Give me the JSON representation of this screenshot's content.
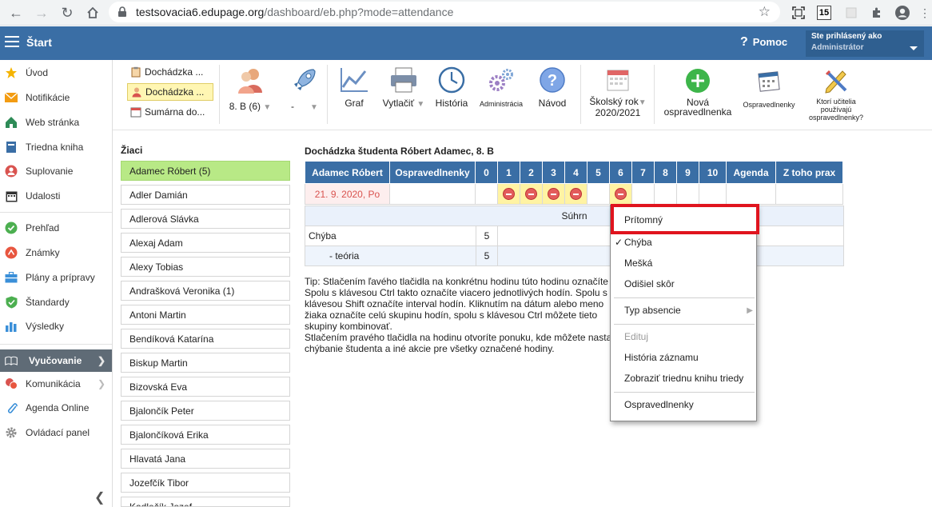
{
  "browser": {
    "host": "testsovacia6.edupage.org",
    "path": "/dashboard/eb.php?mode=attendance",
    "ext_badge": "15"
  },
  "appbar": {
    "title": "Štart",
    "help": "Pomoc",
    "user_line1": "Ste prihlásený ako",
    "user_line2": "Administrátor"
  },
  "sidebar": {
    "items": [
      {
        "label": "Úvod"
      },
      {
        "label": "Notifikácie"
      },
      {
        "label": "Web stránka"
      },
      {
        "label": "Triedna kniha"
      },
      {
        "label": "Suplovanie"
      },
      {
        "label": "Udalosti"
      },
      {
        "label": "Prehľad"
      },
      {
        "label": "Známky"
      },
      {
        "label": "Plány a prípravy"
      },
      {
        "label": "Štandardy"
      },
      {
        "label": "Výsledky"
      },
      {
        "label": "Vyučovanie"
      },
      {
        "label": "Komunikácia"
      },
      {
        "label": "Agenda Online"
      },
      {
        "label": "Ovládací panel"
      }
    ],
    "colors": {
      "active_bg": "#5f6b76",
      "brand": "#3a6ea5"
    }
  },
  "toolbar": {
    "views": [
      "Dochádzka ...",
      "Dochádzka ...",
      "Sumárna do..."
    ],
    "class_select": "8. B (6)",
    "dash_select": "-",
    "graf": "Graf",
    "print": "Vytlačiť",
    "history": "História",
    "admin": "Administrácia",
    "guide": "Návod",
    "year_l1": "Školský rok",
    "year_l2": "2020/2021",
    "new_l1": "Nová",
    "new_l2": "ospravedlnenka",
    "excuses": "Ospravedlnenky",
    "teachers_l1": "Ktorí učitelia",
    "teachers_l2": "používajú",
    "teachers_l3": "ospravedlnenky?"
  },
  "students": {
    "title": "Žiaci",
    "list": [
      "Adamec Róbert (5)",
      "Adler Damián",
      "Adlerová Slávka",
      "Alexaj Adam",
      "Alexy Tobias",
      "Andrašková Veronika (1)",
      "Antoni Martin",
      "Bendíková Katarína",
      "Biskup Martin",
      "Bizovská Eva",
      "Bjalončík Peter",
      "Bjalončíková Erika",
      "Hlavatá Jana",
      "Jozefčík Tibor",
      "Kadlečík Jozef"
    ]
  },
  "attendance": {
    "title": "Dochádzka študenta Róbert Adamec, 8. B",
    "headers": [
      "Adamec Róbert",
      "Ospravedlnenky",
      "0",
      "1",
      "2",
      "3",
      "4",
      "5",
      "6",
      "7",
      "8",
      "9",
      "10",
      "Agenda",
      "Z toho prax"
    ],
    "row_date": "21. 9. 2020, Po",
    "absent_hours": [
      1,
      2,
      3,
      4,
      6
    ],
    "summary_title": "Súhrn",
    "summary_rows": [
      {
        "label": "Chýba",
        "value": "5"
      },
      {
        "label": "- teória",
        "value": "5"
      }
    ]
  },
  "tip": {
    "text": "Tip: Stlačením ľavého tlačidla na konkrétnu hodinu túto hodinu označíte\nSpolu s klávesou Ctrl takto označíte viacero jednotlivých hodín. Spolu s\nklávesou Shift označíte interval hodín. Kliknutím na dátum alebo meno\nžiaka označíte celú skupinu hodín, spolu s klávesou Ctrl môžete tieto\nskupiny kombinovať.\nStlačením pravého tlačidla na hodinu otvoríte ponuku, kde môžete nasta\nchýbanie študenta a iné akcie pre všetky označené hodiny."
  },
  "context_menu": {
    "present": "Prítomný",
    "check": "✓",
    "absent": "Chýba",
    "late": "Mešká",
    "left_early": "Odišiel skôr",
    "absence_type": "Typ absencie",
    "edit": "Edituj",
    "history": "História záznamu",
    "show_book": "Zobraziť triednu knihu triedy",
    "excuses": "Ospravedlnenky",
    "highlight_color": "#e0141e"
  }
}
